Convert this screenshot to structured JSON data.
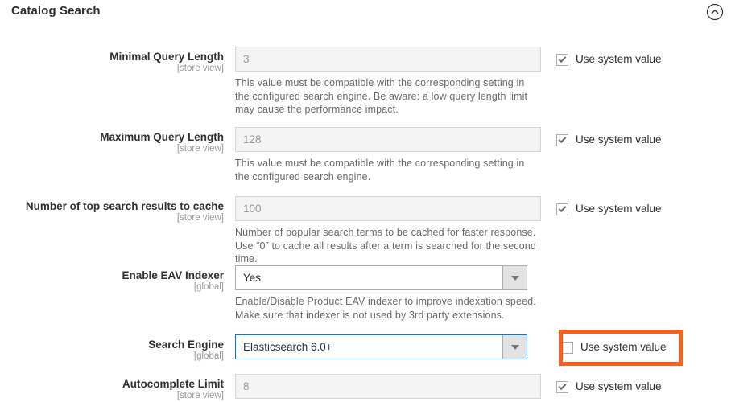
{
  "section": {
    "title": "Catalog Search",
    "collapse_icon": "chevron-up-circle-icon"
  },
  "common": {
    "use_system_value_label": "Use system value",
    "scope_store_view": "[store view]",
    "scope_global": "[global]"
  },
  "colors": {
    "highlight_orange": "#f26322",
    "focus_blue": "#007bdb",
    "label_text": "#303030",
    "note_text": "#6a6a6a",
    "disabled_input_bg": "#f4f4f4",
    "disabled_input_text": "#999999"
  },
  "fields": [
    {
      "id": "minimal-query-length",
      "label": "Minimal Query Length",
      "scope": "[store view]",
      "control": "text",
      "value": "3",
      "note": "This value must be compatible with the corresponding setting in the configured search engine. Be aware: a low query length limit may cause the performance impact.",
      "use_system_value": true,
      "checked": true,
      "highlighted": false
    },
    {
      "id": "maximum-query-length",
      "label": "Maximum Query Length",
      "scope": "[store view]",
      "control": "text",
      "value": "128",
      "note": "This value must be compatible with the corresponding setting in the configured search engine.",
      "use_system_value": true,
      "checked": true,
      "highlighted": false
    },
    {
      "id": "number-of-top-search-results-to-cache",
      "label": "Number of top search results to cache",
      "scope": "[store view]",
      "control": "text",
      "value": "100",
      "note": "Number of popular search terms to be cached for faster response. Use “0” to cache all results after a term is searched for the second time.",
      "use_system_value": true,
      "checked": true,
      "highlighted": false
    },
    {
      "id": "enable-eav-indexer",
      "label": "Enable EAV Indexer",
      "scope": "[global]",
      "control": "select",
      "value": "Yes",
      "note": "Enable/Disable Product EAV indexer to improve indexation speed. Make sure that indexer is not used by 3rd party extensions.",
      "use_system_value": false,
      "checked": false,
      "highlighted": false,
      "focused": false
    },
    {
      "id": "search-engine",
      "label": "Search Engine",
      "scope": "[global]",
      "control": "select",
      "value": "Elasticsearch 6.0+",
      "note": "",
      "use_system_value": true,
      "checked": false,
      "highlighted": true,
      "focused": true
    },
    {
      "id": "autocomplete-limit",
      "label": "Autocomplete Limit",
      "scope": "[store view]",
      "control": "text",
      "value": "8",
      "note": "",
      "use_system_value": true,
      "checked": true,
      "highlighted": false
    }
  ]
}
